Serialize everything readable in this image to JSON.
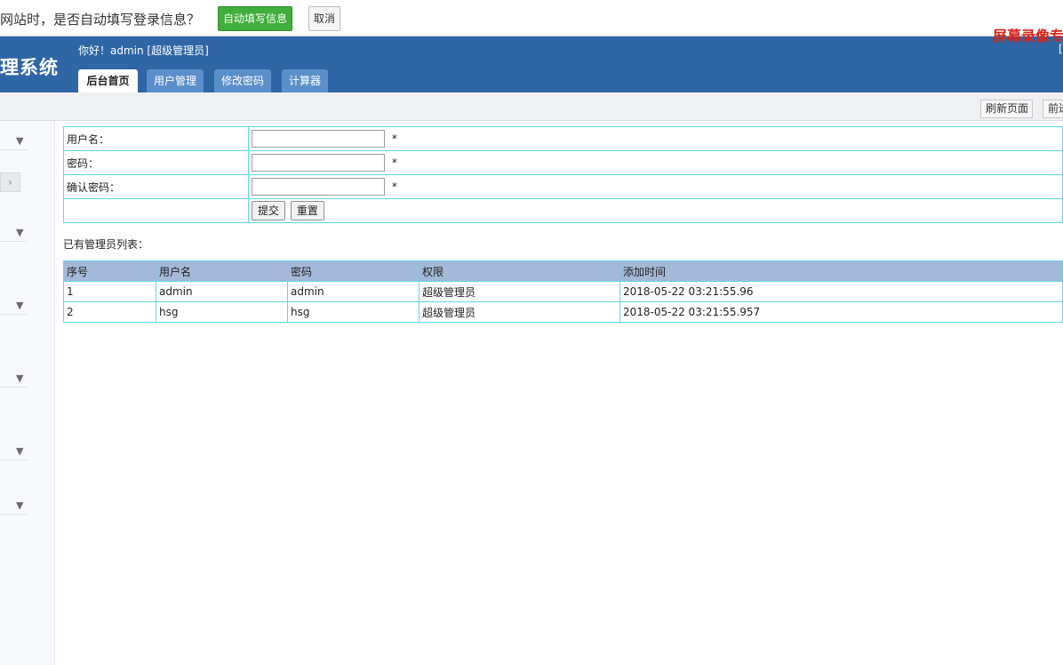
{
  "autofill": {
    "message": "网站时，是否自动填写登录信息？",
    "fill_label": "自动填写信息",
    "cancel_label": "取消"
  },
  "header": {
    "system_title": "理系统",
    "greeting": "你好！admin [超级管理员]",
    "right_cut": "[",
    "watermark": "屏幕录像专"
  },
  "tabs": [
    {
      "label": "后台首页",
      "active": true
    },
    {
      "label": "用户管理",
      "active": false
    },
    {
      "label": "修改密码",
      "active": false
    },
    {
      "label": "计算器",
      "active": false
    }
  ],
  "toolbar": {
    "refresh_label": "刷新页面",
    "forward_label": "前进"
  },
  "sidebar": {
    "arrow_glyph": "▼",
    "collapse_glyph": "›"
  },
  "form": {
    "username_label": "用户名：",
    "password_label": "密码：",
    "confirm_label": "确认密码：",
    "required_mark": "*",
    "submit_label": "提交",
    "reset_label": "重置"
  },
  "list_title": "已有管理员列表：",
  "admin_table": {
    "headers": [
      "序号",
      "用户名",
      "密码",
      "权限",
      "添加时间"
    ],
    "rows": [
      [
        "1",
        "admin",
        "admin",
        "超级管理员",
        "2018-05-22 03:21:55.96"
      ],
      [
        "2",
        "hsg",
        "hsg",
        "超级管理员",
        "2018-05-22 03:21:55.957"
      ]
    ]
  },
  "colors": {
    "header_bg": "#2f66a6",
    "tab_bg": "#5b8fc9",
    "autofill_green": "#3fae3a",
    "table_border": "#62d6e6",
    "table_header_bg": "#a4b8d8",
    "watermark_red": "#d8231a"
  }
}
